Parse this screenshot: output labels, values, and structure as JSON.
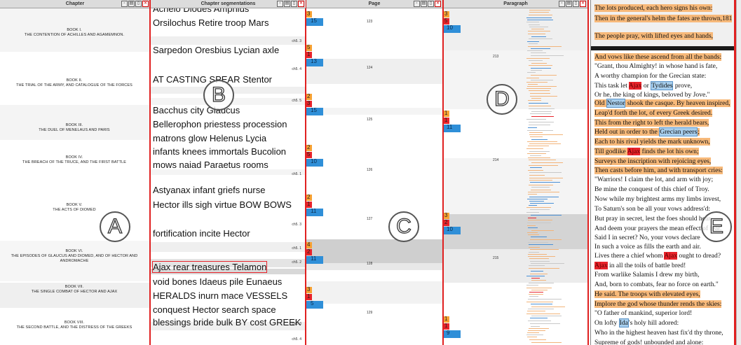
{
  "headers": {
    "chapter": "Chapter",
    "segments": "Chapter segmentations",
    "page": "Page",
    "paragraph": "Paragraph"
  },
  "chapters": [
    {
      "book": "BOOK I.",
      "title": "THE CONTENTION OF ACHILLES AND AGAMEMNON."
    },
    {
      "book": "BOOK II.",
      "title": "THE TRIAL OF THE ARMY, AND CATALOGUE OF THE FORCES"
    },
    {
      "book": "BOOK III.",
      "title": "THE DUEL OF MENELAUS AND PARIS"
    },
    {
      "book": "BOOK IV.",
      "title": "THE BREACH OF THE TRUCE, AND THE FIRST BATTLE"
    },
    {
      "book": "BOOK V.",
      "title": "THE ACTS OF DIOMED"
    },
    {
      "book": "BOOK VI.",
      "title": "THE EPISODES OF GLAUCUS AND DIOMED, AND OF HECTOR AND ANDROMACHE"
    },
    {
      "book": "BOOK VII.",
      "title": "THE SINGLE COMBAT OF HECTOR AND AJAX"
    },
    {
      "book": "BOOK VIII.",
      "title": "THE SECOND BATTLE, AND THE DISTRESS OF THE GREEKS"
    }
  ],
  "segments": {
    "lines": [
      "Achelo Diodes Amphius",
      "Orsilochus Retire troop Mars",
      "Sarpedon Oresbius Lycian axle",
      "AT CASTING SPEAR Stentor",
      "Bacchus city Glaucus",
      "Bellerophon priestess procession",
      "matrons glow Helenus Lycia",
      "infants knees immortals Bucolion",
      "mows naiad Paraetus rooms",
      "Astyanax infant griefs nurse",
      "Hector ills sigh virtue BOW BOWS",
      "fortification incite Hector",
      "Ajax rear treasures Telamon",
      "void bones Idaeus pile Eunaeus",
      "HERALDS inurn mace VESSELS",
      "conquest Hector search space",
      "blessings bride bulk BY cost GREEK"
    ],
    "tags": [
      "ch5. 3",
      "ch5. 4",
      "ch5. 5",
      "ch5. 1",
      "ch5. 3",
      "ch5. 1",
      "ch5. 2",
      "ch5. 3",
      "ch5. 4"
    ]
  },
  "page_markers": [
    {
      "num": "123",
      "marks": [
        "3",
        "15"
      ]
    },
    {
      "num": "124",
      "marks": [
        "5",
        "1",
        "13"
      ]
    },
    {
      "num": "125",
      "marks": [
        "2",
        "3",
        "15"
      ]
    },
    {
      "num": "126",
      "marks": [
        "2",
        "5",
        "10"
      ]
    },
    {
      "num": "127",
      "marks": [
        "2",
        "1",
        "11"
      ]
    },
    {
      "num": "128",
      "marks": [
        "4",
        "2",
        "11"
      ]
    },
    {
      "num": "129",
      "marks": [
        "3",
        "1",
        "5"
      ]
    }
  ],
  "paragraph_markers": {
    "pages": [
      "213",
      "214",
      "215"
    ],
    "groups": [
      [
        "3",
        "5",
        "10"
      ],
      [
        "1",
        "1",
        "11"
      ],
      [
        "3",
        "2",
        "10"
      ],
      [
        "1",
        "1",
        "9"
      ]
    ]
  },
  "letters": [
    "A",
    "B",
    "C",
    "D",
    "E"
  ],
  "text_lines": [
    {
      "parts": [
        {
          "t": "The lots produced, each hero signs his own:",
          "h": "o"
        }
      ]
    },
    {
      "parts": [
        {
          "t": "Then in the general's helm the fates are thrown,181",
          "h": "o"
        }
      ]
    },
    {
      "parts": [
        {
          "t": "The people pray, with lifted eyes and hands,",
          "h": "o"
        }
      ]
    },
    {
      "parts": [
        {
          "t": "And vows like these ascend from all the bands:",
          "h": "o"
        }
      ]
    },
    {
      "parts": [
        {
          "t": "\"Grant, thou Almighty! in whose hand is fate,",
          "h": ""
        }
      ]
    },
    {
      "parts": [
        {
          "t": "A worthy champion for the Grecian state:",
          "h": ""
        }
      ]
    },
    {
      "parts": [
        {
          "t": "This task let ",
          "h": ""
        },
        {
          "t": "Ajax",
          "h": "r"
        },
        {
          "t": " or ",
          "h": ""
        },
        {
          "t": "Tydides",
          "h": "b"
        },
        {
          "t": " prove,",
          "h": ""
        }
      ]
    },
    {
      "parts": [
        {
          "t": "Or he, the king of kings, beloved by Jove.\"",
          "h": ""
        }
      ]
    },
    {
      "parts": [
        {
          "t": "Old ",
          "h": "o"
        },
        {
          "t": "Nestor",
          "h": "b"
        },
        {
          "t": " shook the casque.  By heaven inspired,",
          "h": "o"
        }
      ]
    },
    {
      "parts": [
        {
          "t": "Leap'd forth the lot, of every Greek desired.",
          "h": "o"
        }
      ]
    },
    {
      "parts": [
        {
          "t": "This from the right to left the herald bears,",
          "h": "o"
        }
      ]
    },
    {
      "parts": [
        {
          "t": "Held out in order to the ",
          "h": "o"
        },
        {
          "t": "Grecian peers",
          "h": "b"
        },
        {
          "t": ";",
          "h": "o"
        }
      ]
    },
    {
      "parts": [
        {
          "t": "Each to his rival yields the mark unknown,",
          "h": "o"
        }
      ]
    },
    {
      "parts": [
        {
          "t": "Till godlike ",
          "h": "o"
        },
        {
          "t": "Ajax",
          "h": "r"
        },
        {
          "t": " finds the lot his own;",
          "h": "o"
        }
      ]
    },
    {
      "parts": [
        {
          "t": "Surveys the inscription with rejoicing eyes,",
          "h": "o"
        }
      ]
    },
    {
      "parts": [
        {
          "t": "Then casts before him, and with transport cries:",
          "h": "o"
        }
      ]
    },
    {
      "parts": [
        {
          "t": "\"Warriors! I claim the lot, and arm with joy;",
          "h": ""
        }
      ]
    },
    {
      "parts": [
        {
          "t": "Be mine the conquest of this chief of Troy.",
          "h": ""
        }
      ]
    },
    {
      "parts": [
        {
          "t": "Now while my brightest arms my limbs invest,",
          "h": ""
        }
      ]
    },
    {
      "parts": [
        {
          "t": "To Saturn's son be all your vows address'd:",
          "h": ""
        }
      ]
    },
    {
      "parts": [
        {
          "t": "But pray in secret, lest the foes should hear",
          "h": ""
        }
      ]
    },
    {
      "parts": [
        {
          "t": "And deem your prayers the mean effect of fear.",
          "h": ""
        }
      ]
    },
    {
      "parts": [
        {
          "t": "Said I in secret? No, your vows declare",
          "h": ""
        }
      ]
    },
    {
      "parts": [
        {
          "t": "In such a voice as fills the earth and air.",
          "h": ""
        }
      ]
    },
    {
      "parts": [
        {
          "t": "Lives there a chief whom ",
          "h": ""
        },
        {
          "t": "Ajax",
          "h": "r"
        },
        {
          "t": " ought to dread?",
          "h": ""
        }
      ]
    },
    {
      "parts": [
        {
          "t": "Ajax",
          "h": "r"
        },
        {
          "t": " in all the toils of battle bred!",
          "h": ""
        }
      ]
    },
    {
      "parts": [
        {
          "t": "From warlike Salamis I drew my birth,",
          "h": ""
        }
      ]
    },
    {
      "parts": [
        {
          "t": "And, born to combats, fear no force on earth.\"",
          "h": ""
        }
      ]
    },
    {
      "parts": [
        {
          "t": "He said.  The troops with elevated eyes,",
          "h": "o"
        }
      ]
    },
    {
      "parts": [
        {
          "t": "Implore the god whose thunder rends the skies:",
          "h": "o"
        }
      ]
    },
    {
      "parts": [
        {
          "t": "\"O father of mankind, superior lord!",
          "h": ""
        }
      ]
    },
    {
      "parts": [
        {
          "t": "On lofty ",
          "h": ""
        },
        {
          "t": "Ida",
          "h": "b"
        },
        {
          "t": "'s holy hill adored:",
          "h": ""
        }
      ]
    },
    {
      "parts": [
        {
          "t": "Who in the highest heaven hast fix'd thy throne,",
          "h": ""
        }
      ]
    },
    {
      "parts": [
        {
          "t": "Supreme of gods! unbounded and alone:",
          "h": ""
        }
      ]
    }
  ],
  "colors": {
    "marker_orange": "#f7a233",
    "marker_red": "#e8232a",
    "marker_purple": "#c5a6d3",
    "marker_blue": "#2f8fd8",
    "highlight_orange": "#f7b97a",
    "divider_red": "#e02020"
  }
}
